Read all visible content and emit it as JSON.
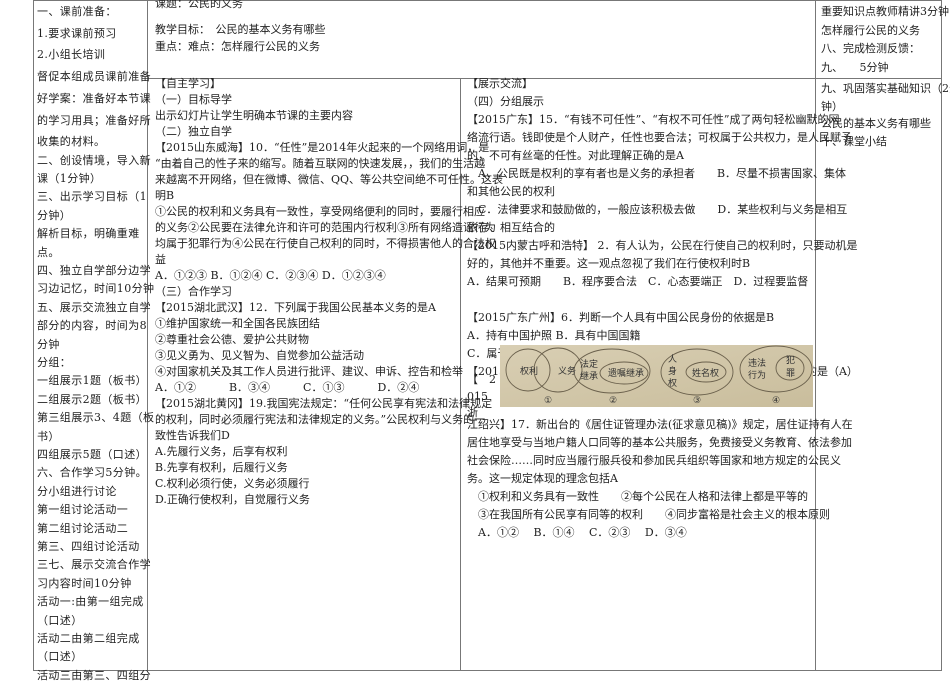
{
  "header": {
    "title": "课题：公民的义务",
    "goal": "教学目标：　公民的基本义务有哪些",
    "key_points": "重点：难点：怎样履行公民的义务"
  },
  "left_column": [
    "一、课前准备：",
    "1.要求课前预习",
    "2.小组长培训",
    "督促本组成员课前准备",
    "好学案：准备好本节课",
    "的学习用具；准备好所",
    "收集的材料。",
    "二、创设情境，导入新",
    "课（1分钟）",
    "三、出示学习目标（1",
    "分钟）",
    "解析目标，明确重难",
    "点。",
    "四、独立自学部分边学",
    "习边记忆，时间10分钟",
    "五、展示交流独立自学",
    "部分的内容，时间为8",
    "分钟",
    "分组：",
    "一组展示1题（板书）",
    "二组展示2题（板书）",
    "第三组展示3、4题（板",
    "书）",
    "四组展示5题（口述）",
    "六、合作学习5分钟。",
    "分小组进行讨论",
    "第一组讨论活动一",
    "第二组讨论活动二",
    "第三、四组讨论活动",
    " 三七、展示交流合作学",
    "习内容时间10分钟",
    "活动一:由第一组完成",
    "（口述）",
    "活动二由第二组完成",
    "（口述）",
    "活动三由第三、四组分"
  ],
  "self_study": [
    "【自主学习】",
    "（一）目标导学",
    "出示幻灯片让学生明确本节课的主要内容",
    "（二）独立自学",
    "【2015山东威海】10．“任性”是2014年火起来的一个网络用词，是",
    "“由着自己的性子来的缩写。随着互联网的快速发展，，我们的生活越",
    "来越离不开网络，但在微博、微信、QQ、等公共空间绝不可任性。这表",
    "明B",
    "①公民的权利和义务具有一致性，享受网络便利的同时，要履行相应",
    "的义务②公民要在法律允许和许可的范围内行权利③所有网络造谣行为",
    "均属于犯罪行为④公民在行使自己权利的同时，不得损害他人的合法权",
    "益",
    "A．①②③ B．①②④ C．②③④ D．①②③④",
    "（三）合作学习",
    "【2015湖北武汉】12．下列属于我国公民基本义务的是A",
    "①维护国家统一和全国各民族团结",
    "②尊重社会公德、爱护公共财物",
    "③见义勇为、见义智为、自觉参加公益活动",
    "④对国家机关及其工作人员进行批评、建议、申诉、控告和检举",
    "A．①②　　　B．③④　　　C．①③　　　D．②④",
    "【2015湖北黄冈】19.我国宪法规定：“任何公民享有宪法和法律规定",
    "的权利，同时必须履行宪法和法律规定的义务。”公民权利与义务的一",
    "致性告诉我们D",
    "A.先履行义务，后享有权利",
    "B.先享有权利，后履行义务",
    "C.权利必须行使，义务必须履行",
    "D.正确行使权利，自觉履行义务"
  ],
  "exchange": [
    "【展示交流】",
    "（四）分组展示",
    "【2015广东】15．“有钱不可任性”、“有权不可任性”成了两句轻松幽默的网",
    "络流行语。钱即使是个人财产，任性也要合法；可权属于公共权力，是人民赋予",
    "的，不可有丝毫的任性。对此理解正确的是A",
    "　A．公民既是权利的享有者也是义务的承担者　　B．尽量不损害国家、集体",
    "和其他公民的权利",
    "　C．法律要求和鼓励做的，一般应该积极去做　　D．某些权利与义务是相互",
    "依存、相互结合的",
    "【2015内蒙古呼和浩特】 2．有人认为，公民在行使自己的权利时，只要动机是",
    "好的，其他并不重要。这一观点忽视了我们在行使权利时B",
    "A．结果可预期　　B．程序要合法　C．心态要端正　D．过程要监督",
    "",
    "【2015广东广州】6．判断一个人具有中国公民身份的依据是B",
    "A．持有中国护照 B．具有中国国籍",
    "C．属于某一民族 D．信仰某种宗教",
    "【2015山东泰安】14．对下列图示所表达的概念间的关系，理解错误的是（A）"
  ],
  "exchange_side": [
    "【　2",
    "015",
    "浙"
  ],
  "exchange_tail": [
    "江绍兴】17．新出台的《居住证管理办法(征求意见稿)》规定，居住证持有人在",
    "居住地享受与当地户籍人口同等的基本公共服务，免费接受义务教育、依法参加",
    "社会保险……同时应当履行服兵役和参加民兵组织等国家和地方规定的公民义",
    "务。这一规定体现的理念包括A",
    "　①权利和义务具有一致性　　②每个公民在人格和法律上都是平等的",
    "　③在我国所有公民享有同等的权利　　④同步富裕是社会主义的根本原则",
    "　A．①②　 B．①④　 C．②③　 D．③④"
  ],
  "diagram": {
    "d1": [
      "权利",
      "义务",
      "①"
    ],
    "d2": [
      "法定",
      "继承",
      "遗嘱继承",
      "②"
    ],
    "d3": [
      "人",
      "身",
      "权",
      "姓名权",
      "③"
    ],
    "d4": [
      "违法",
      "行为",
      "犯",
      "罪",
      "④"
    ]
  },
  "right_top": [
    "重要知识点教师精讲3分钟",
    "怎样履行公民的义务",
    "八、完成检测反馈：",
    "九、　　5分钟"
  ],
  "right_bottom": [
    "九、巩固落实基础知识（2分",
    "钟）",
    "公民的基本义务有哪些",
    "十、课堂小结"
  ]
}
